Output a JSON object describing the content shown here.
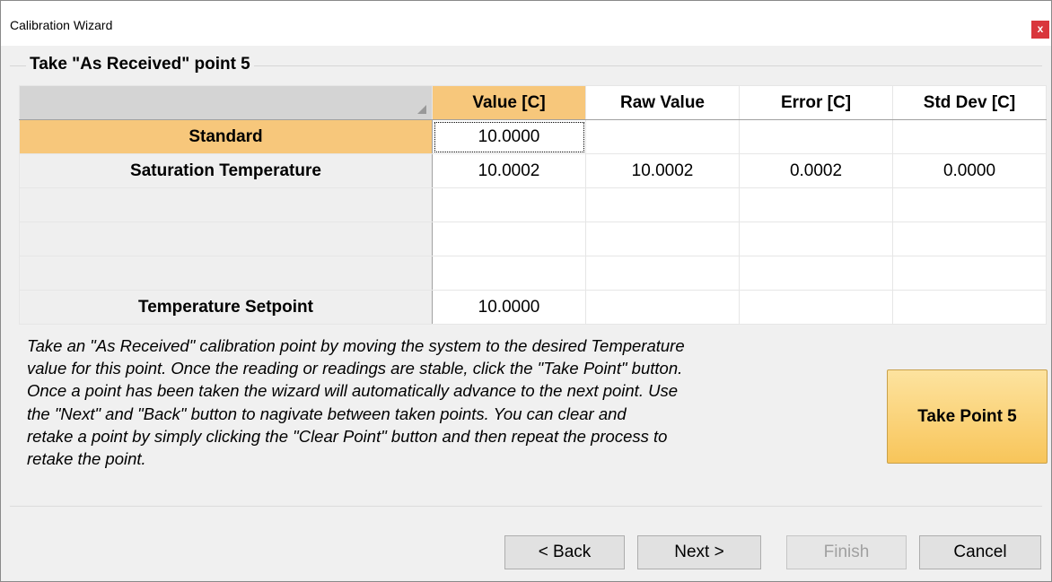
{
  "window": {
    "title": "Calibration Wizard",
    "close_label": "x"
  },
  "group": {
    "title": "Take \"As Received\" point 5"
  },
  "table": {
    "columns": [
      "Value [C]",
      "Raw Value",
      "Error [C]",
      "Std Dev [C]"
    ],
    "rows": [
      {
        "label": "Standard",
        "cells": [
          "10.0000",
          "",
          "",
          ""
        ]
      },
      {
        "label": "Saturation Temperature",
        "cells": [
          "10.0002",
          "10.0002",
          "0.0002",
          "0.0000"
        ]
      },
      {
        "label": "",
        "cells": [
          "",
          "",
          "",
          ""
        ]
      },
      {
        "label": "",
        "cells": [
          "",
          "",
          "",
          ""
        ]
      },
      {
        "label": "",
        "cells": [
          "",
          "",
          "",
          ""
        ]
      },
      {
        "label": "Temperature Setpoint",
        "cells": [
          "10.0000",
          "",
          "",
          ""
        ]
      }
    ]
  },
  "description": "Take an \"As Received\" calibration point by moving the system to the desired Temperature\nvalue for this point.  Once the reading or readings are stable, click the \"Take Point\" button.\n Once a point has been taken the wizard will automatically advance to the next point.  Use\nthe \"Next\" and \"Back\" button to nagivate between taken points.  You can clear and\nretake a point by simply clicking the \"Clear Point\" button and then repeat the process to\nretake the point.",
  "take_point": {
    "label": "Take Point 5"
  },
  "buttons": {
    "back": "< Back",
    "next": "Next >",
    "finish": "Finish",
    "cancel": "Cancel"
  },
  "colors": {
    "accent": "#f7c77b",
    "close": "#d9363c"
  }
}
